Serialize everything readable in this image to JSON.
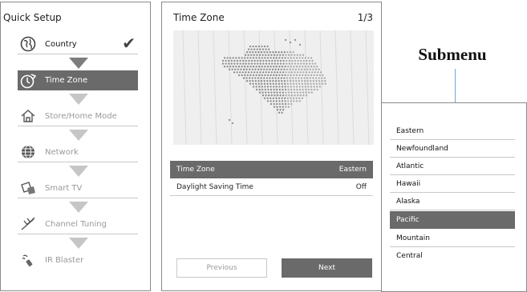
{
  "quick_setup": {
    "title": "Quick Setup",
    "items": [
      {
        "label": "Country",
        "icon": "globe-icon",
        "state": "done"
      },
      {
        "label": "Time Zone",
        "icon": "clock-icon",
        "state": "active"
      },
      {
        "label": "Store/Home Mode",
        "icon": "house-icon",
        "state": "pending"
      },
      {
        "label": "Network",
        "icon": "network-globe-icon",
        "state": "pending"
      },
      {
        "label": "Smart TV",
        "icon": "smart-tv-icon",
        "state": "pending"
      },
      {
        "label": "Channel Tuning",
        "icon": "antenna-icon",
        "state": "pending"
      },
      {
        "label": "IR Blaster",
        "icon": "ir-blaster-icon",
        "state": "pending"
      }
    ]
  },
  "time_zone": {
    "title": "Time Zone",
    "page": "1/3",
    "rows": [
      {
        "label": "Time Zone",
        "value": "Eastern",
        "selected": true
      },
      {
        "label": "Daylight Saving Time",
        "value": "Off",
        "selected": false
      }
    ],
    "previous_label": "Previous",
    "next_label": "Next"
  },
  "submenu": {
    "callout": "Submenu",
    "options": [
      "Eastern",
      "Newfoundland",
      "Atlantic",
      "Hawaii",
      "Alaska",
      "Pacific",
      "Mountain",
      "Central"
    ],
    "selected": "Pacific"
  },
  "colors": {
    "highlight": "#6a6a6a",
    "arrow_active": "#7d7d7d",
    "arrow_inactive": "#c6c6c6",
    "map_bg": "#efefef"
  }
}
